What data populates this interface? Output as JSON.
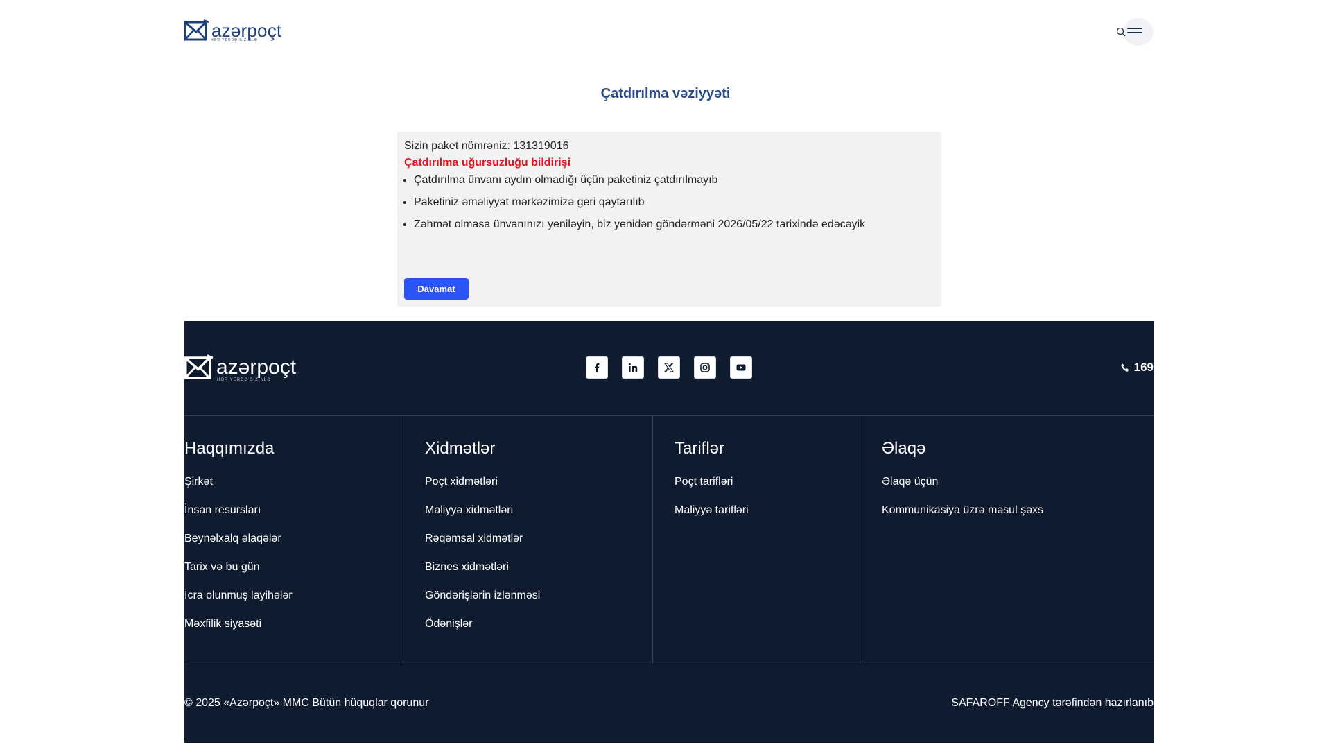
{
  "header": {
    "logo_text": "azərpoçt",
    "logo_tagline": "HƏR YERDƏ SİZİNLƏ"
  },
  "page": {
    "title": "Çatdırılma vəziyyəti"
  },
  "status_card": {
    "package_line": "Sizin paket nömrəniz: 131319016",
    "failure_title": "Çatdırılma uğursuzluğu bildirişi",
    "bullets": [
      "Çatdırılma ünvanı aydın olmadığı üçün paketiniz çatdırılmayıb",
      "Paketiniz əməliyyat mərkəzimizə geri qaytarılıb",
      "Zəhmət olmasa ünvanınızı yeniləyin, biz yenidən göndərməni 2026/05/22 tarixində edəcəyik"
    ],
    "continue_label": "Davamat"
  },
  "footer": {
    "logo_text": "azərpoçt",
    "logo_tagline": "HƏR YERDƏ SİZİNLƏ",
    "phone": "169",
    "columns": [
      {
        "title": "Haqqımızda",
        "links": [
          "Şirkət",
          "İnsan resursları",
          "Beynəlxalq əlaqələr",
          "Tarix və bu gün",
          "İcra olunmuş layihələr",
          "Məxfilik siyasəti"
        ]
      },
      {
        "title": "Xidmətlər",
        "links": [
          "Poçt xidmətləri",
          "Maliyyə xidmətləri",
          "Rəqəmsal xidmətlər",
          "Biznes xidmətləri",
          "Göndərişlərin izlənməsi",
          "Ödənişlər"
        ]
      },
      {
        "title": "Tariflər",
        "links": [
          "Poçt tarifləri",
          "Maliyyə tarifləri"
        ]
      },
      {
        "title": "Əlaqə",
        "links": [
          "Əlaqə üçün",
          "Kommunikasiya üzrə məsul şəxs"
        ]
      }
    ],
    "copyright": "© 2025 «Azərpoçt» MMC Bütün hüquqlar qorunur",
    "credit": "SAFAROFF Agency tərəfindən hazırlanıb"
  },
  "colors": {
    "brand_blue": "#1d3f7a",
    "title_blue": "#2a4c8f",
    "error_red": "#e3141b",
    "button_blue": "#2d55f5",
    "footer_bg": "#0f1c2f"
  },
  "icons": [
    "search-icon",
    "menu-icon",
    "facebook-icon",
    "linkedin-icon",
    "x-icon",
    "instagram-icon",
    "youtube-icon",
    "phone-icon"
  ]
}
